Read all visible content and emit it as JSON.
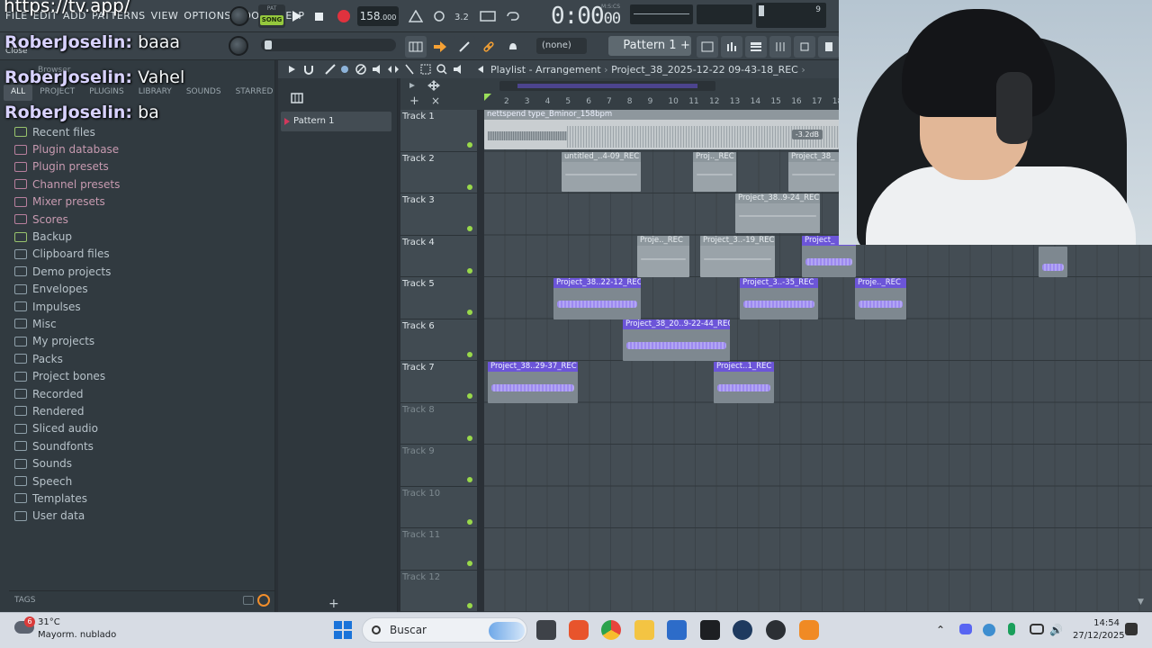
{
  "overlay": {
    "url": "https://tv.app/",
    "chat": [
      {
        "user": "RoberJoselin:",
        "msg": "baaa"
      },
      {
        "user": "RoberJoselin:",
        "msg": "Vahel"
      },
      {
        "user": "RoberJoselin:",
        "msg": "ba"
      }
    ],
    "close_label": "Close"
  },
  "menu": [
    "FILE",
    "EDIT",
    "ADD",
    "PATTERNS",
    "VIEW",
    "OPTIONS",
    "TOOLS",
    "HELP"
  ],
  "transport": {
    "pat_label": "PAT",
    "song_label": "SONG",
    "tempo": "158",
    "tempo_decimal": ".000",
    "time": "0:00",
    "time_small": "00",
    "time_unit": "M:S:CS",
    "cpu_value": "9"
  },
  "toolbar2": {
    "none_label": "(none)",
    "pattern_label": "Pattern 1"
  },
  "browser": {
    "tabs": [
      "ALL",
      "PROJECT",
      "PLUGINS",
      "LIBRARY",
      "SOUNDS",
      "STARRED"
    ],
    "browser_label": "Browser",
    "items": [
      {
        "label": "Recent files",
        "style": "green"
      },
      {
        "label": "Plugin database",
        "style": "pink"
      },
      {
        "label": "Plugin presets",
        "style": "pink"
      },
      {
        "label": "Channel presets",
        "style": "pink"
      },
      {
        "label": "Mixer presets",
        "style": "pink"
      },
      {
        "label": "Scores",
        "style": "pink"
      },
      {
        "label": "Backup",
        "style": "green"
      },
      {
        "label": "Clipboard files",
        "style": "plain"
      },
      {
        "label": "Demo projects",
        "style": "plain"
      },
      {
        "label": "Envelopes",
        "style": "plain"
      },
      {
        "label": "Impulses",
        "style": "plain"
      },
      {
        "label": "Misc",
        "style": "plain"
      },
      {
        "label": "My projects",
        "style": "plain"
      },
      {
        "label": "Packs",
        "style": "plain"
      },
      {
        "label": "Project bones",
        "style": "plain"
      },
      {
        "label": "Recorded",
        "style": "plain"
      },
      {
        "label": "Rendered",
        "style": "plain"
      },
      {
        "label": "Sliced audio",
        "style": "plain"
      },
      {
        "label": "Soundfonts",
        "style": "plain"
      },
      {
        "label": "Sounds",
        "style": "plain"
      },
      {
        "label": "Speech",
        "style": "plain"
      },
      {
        "label": "Templates",
        "style": "plain"
      },
      {
        "label": "User data",
        "style": "plain"
      }
    ],
    "tags_label": "TAGS"
  },
  "patterns": {
    "items": [
      "Pattern 1"
    ]
  },
  "playlist": {
    "title": "Playlist - Arrangement",
    "project": "Project_38_2025-12-22 09-43-18_REC",
    "ruler": [
      "2",
      "3",
      "4",
      "5",
      "6",
      "7",
      "8",
      "9",
      "10",
      "11",
      "12",
      "13",
      "14",
      "15",
      "16",
      "17",
      "18"
    ],
    "tracks": [
      "Track 1",
      "Track 2",
      "Track 3",
      "Track 4",
      "Track 5",
      "Track 6",
      "Track 7",
      "Track 8",
      "Track 9",
      "Track 10",
      "Track 11",
      "Track 12"
    ],
    "clips": [
      {
        "name": "nettspend type_Bminor_158bpm",
        "gain": "-3.2dB"
      },
      {
        "name": "untitled_..4-09_REC"
      },
      {
        "name": "Proj.._REC"
      },
      {
        "name": "Project_38_"
      },
      {
        "name": "Project_38..9-24_REC"
      },
      {
        "name": "Proje.._REC"
      },
      {
        "name": "Project_3..-19_REC"
      },
      {
        "name": "Project_"
      },
      {
        "name": "Project_38..22-12_REC"
      },
      {
        "name": "Project_3..-35_REC"
      },
      {
        "name": "Proje.._REC"
      },
      {
        "name": "Project_38_20..9-22-44_REC"
      },
      {
        "name": "Project_38..29-37_REC"
      },
      {
        "name": "Project..1_REC"
      }
    ]
  },
  "taskbar": {
    "weather_badge": "6",
    "temperature": "31°C",
    "weather": "Mayorm. nublado",
    "search": "Buscar",
    "time": "14:54",
    "date": "27/12/2025"
  }
}
